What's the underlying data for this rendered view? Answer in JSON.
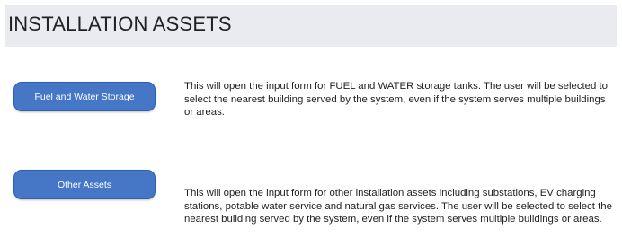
{
  "header": {
    "title": "INSTALLATION ASSETS"
  },
  "assets": [
    {
      "button_label": "Fuel and Water Storage",
      "description": "This will open the input form for FUEL and WATER storage tanks. The user will be selected to select the nearest building served by the system, even if the system serves multiple buildings or areas."
    },
    {
      "button_label": "Other Assets",
      "description": "This will open the input form for other installation assets including substations, EV charging stations, potable water service and natural gas services. The user will be selected to select the nearest building served by the system, even if the system serves multiple buildings or areas."
    }
  ],
  "colors": {
    "header_band": "#e9ebf1",
    "button_fill": "#4577c6",
    "button_border": "#2f5faa",
    "button_text": "#ffffff"
  }
}
